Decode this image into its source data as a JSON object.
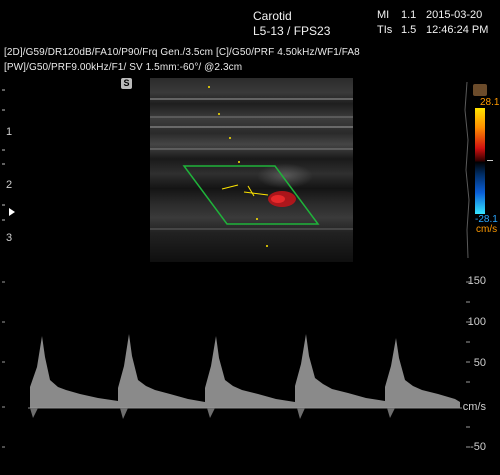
{
  "header": {
    "exam": "Carotid",
    "probe": "L5-13 / FPS23",
    "mi_label": "MI",
    "mi_value": "1.1",
    "tis_label": "TIs",
    "tis_value": "1.5",
    "date": "2015-03-20",
    "time": "12:46:24 PM"
  },
  "params": {
    "line1": "[2D]/G59/DR120dB/FA10/P90/Frq Gen./3.5cm   [C]/G50/PRF 4.50kHz/WF1/FA8",
    "line2": "[PW]/G50/PRF9.00kHz/F1/ SV 1.5mm:-60°/ @2.3cm"
  },
  "depth_scale": {
    "labels": [
      "1",
      "2",
      "3"
    ],
    "marker_icon": "focus-triangle-icon"
  },
  "status_icon_label": "S",
  "color_scale": {
    "top": "28.1",
    "bottom": "-28.1",
    "unit": "cm/s",
    "colors": {
      "positive": "#ff9000",
      "negative": "#0a5fd8"
    }
  },
  "spectrum_scale": {
    "labels": [
      "150",
      "100",
      "50",
      "cm/s",
      "-50"
    ]
  },
  "accents": {
    "roi_box": "#1fb33a",
    "text": "#f2f2f2",
    "tick": "#bfbfbf"
  }
}
